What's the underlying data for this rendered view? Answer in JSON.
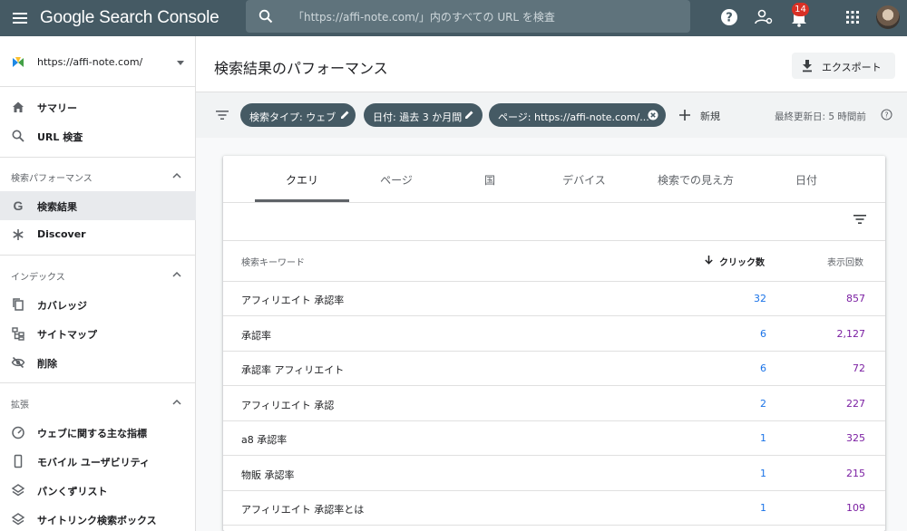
{
  "app": {
    "logo_text": "Google Search Console",
    "search_placeholder": "「https://affi-note.com/」内のすべての URL を検査",
    "notification_count": "14"
  },
  "sidebar": {
    "property": "https://affi-note.com/",
    "top_items": [
      {
        "label": "サマリー",
        "icon": "home-icon"
      },
      {
        "label": "URL 検査",
        "icon": "search-icon"
      }
    ],
    "sections": [
      {
        "title": "検索パフォーマンス",
        "items": [
          {
            "label": "検索結果",
            "icon": "google-g-icon",
            "active": true
          },
          {
            "label": "Discover",
            "icon": "asterisk-icon"
          }
        ]
      },
      {
        "title": "インデックス",
        "items": [
          {
            "label": "カバレッジ",
            "icon": "pages-icon"
          },
          {
            "label": "サイトマップ",
            "icon": "sitemap-icon"
          },
          {
            "label": "削除",
            "icon": "eye-off-icon"
          }
        ]
      },
      {
        "title": "拡張",
        "items": [
          {
            "label": "ウェブに関する主な指標",
            "icon": "gauge-icon"
          },
          {
            "label": "モバイル ユーザビリティ",
            "icon": "phone-icon"
          },
          {
            "label": "パンくずリスト",
            "icon": "layers-icon"
          },
          {
            "label": "サイトリンク検索ボックス",
            "icon": "layers-icon"
          }
        ]
      }
    ]
  },
  "header": {
    "title": "検索結果のパフォーマンス",
    "export_label": "エクスポート"
  },
  "filters": {
    "chips": [
      "検索タイプ: ウェブ",
      "日付: 過去 3 か月間",
      "ページ: https://affi-note.com/..."
    ],
    "new_label": "新規",
    "last_updated": "最終更新日: 5 時間前"
  },
  "tabs": [
    "クエリ",
    "ページ",
    "国",
    "デバイス",
    "検索での見え方",
    "日付"
  ],
  "table": {
    "columns": {
      "query": "検索キーワード",
      "clicks": "クリック数",
      "impressions": "表示回数"
    },
    "rows": [
      {
        "query": "アフィリエイト 承認率",
        "clicks": "32",
        "impressions": "857"
      },
      {
        "query": "承認率",
        "clicks": "6",
        "impressions": "2,127"
      },
      {
        "query": "承認率 アフィリエイト",
        "clicks": "6",
        "impressions": "72"
      },
      {
        "query": "アフィリエイト 承認",
        "clicks": "2",
        "impressions": "227"
      },
      {
        "query": "a8 承認率",
        "clicks": "1",
        "impressions": "325"
      },
      {
        "query": "物販 承認率",
        "clicks": "1",
        "impressions": "215"
      },
      {
        "query": "アフィリエイト 承認率とは",
        "clicks": "1",
        "impressions": "109"
      }
    ]
  },
  "colors": {
    "topbar": "#455a64",
    "clicks": "#1a73e8",
    "impressions": "#7b1fa2",
    "badge": "#d93025"
  }
}
